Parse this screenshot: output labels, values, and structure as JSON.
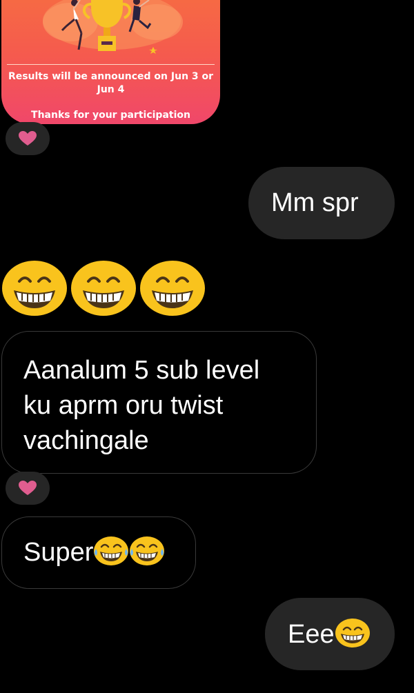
{
  "shared_card": {
    "announcement": "Results will be announced on Jun 3 or Jun 4",
    "thanks": "Thanks for your participation"
  },
  "messages": [
    {
      "type": "sent",
      "text": "Mm spr"
    },
    {
      "type": "received",
      "text": "Aanalum 5 sub level ku aprm oru twist vachingale"
    },
    {
      "type": "received",
      "text": "Super"
    },
    {
      "type": "sent",
      "text": "Eee"
    }
  ],
  "icons": {
    "reaction": "heart-icon",
    "emoji_grin": "grinning-face-icon",
    "emoji_tears": "face-with-tears-of-joy-icon"
  },
  "colors": {
    "background": "#000000",
    "sent_bubble": "#262626",
    "received_border": "#3a3a3a",
    "heart": "#e05d8f",
    "card_gradient_top": "#f6713f",
    "card_gradient_bottom": "#f0476a",
    "emoji_yellow": "#f9c31d"
  }
}
